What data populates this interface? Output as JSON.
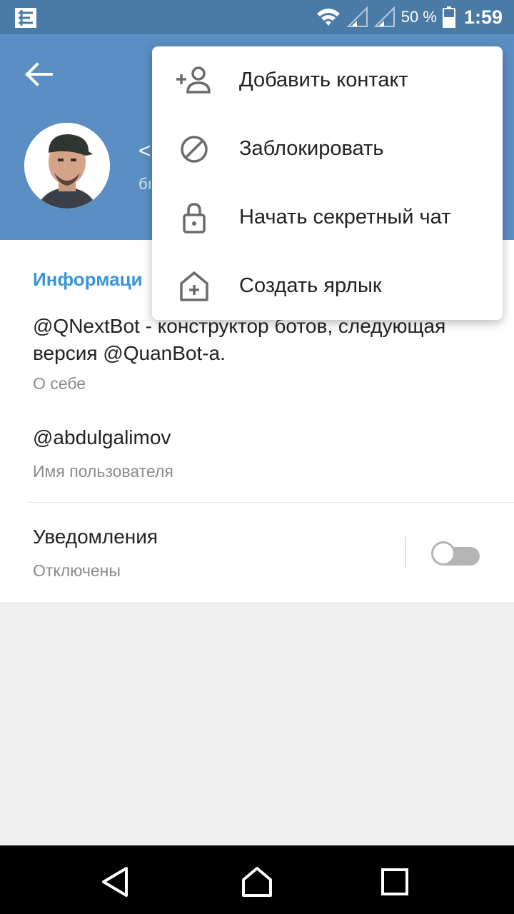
{
  "status_bar": {
    "battery_percent": "50 %",
    "time": "1:59",
    "icons": [
      "app-notification-icon",
      "wifi-icon",
      "signal-icon",
      "signal-icon",
      "battery-icon"
    ]
  },
  "header": {
    "name": "<",
    "status": "бı"
  },
  "info": {
    "section_title": "Информаци",
    "bio": "@QNextBot - конструктор ботов, следующая версия @QuanBot-a.",
    "bio_label": "О себе",
    "username": "@abdulgalimov",
    "username_label": "Имя пользователя"
  },
  "notifications": {
    "title": "Уведомления",
    "status": "Отключены",
    "enabled": false
  },
  "menu": {
    "items": [
      {
        "label": "Добавить контакт",
        "icon": "add-contact-icon"
      },
      {
        "label": "Заблокировать",
        "icon": "block-icon"
      },
      {
        "label": "Начать секретный чат",
        "icon": "lock-icon"
      },
      {
        "label": "Создать ярлык",
        "icon": "add-shortcut-icon"
      }
    ]
  },
  "colors": {
    "header": "#5b8fc3",
    "status_bar": "#4a7aa6",
    "accent": "#3a95d5"
  }
}
